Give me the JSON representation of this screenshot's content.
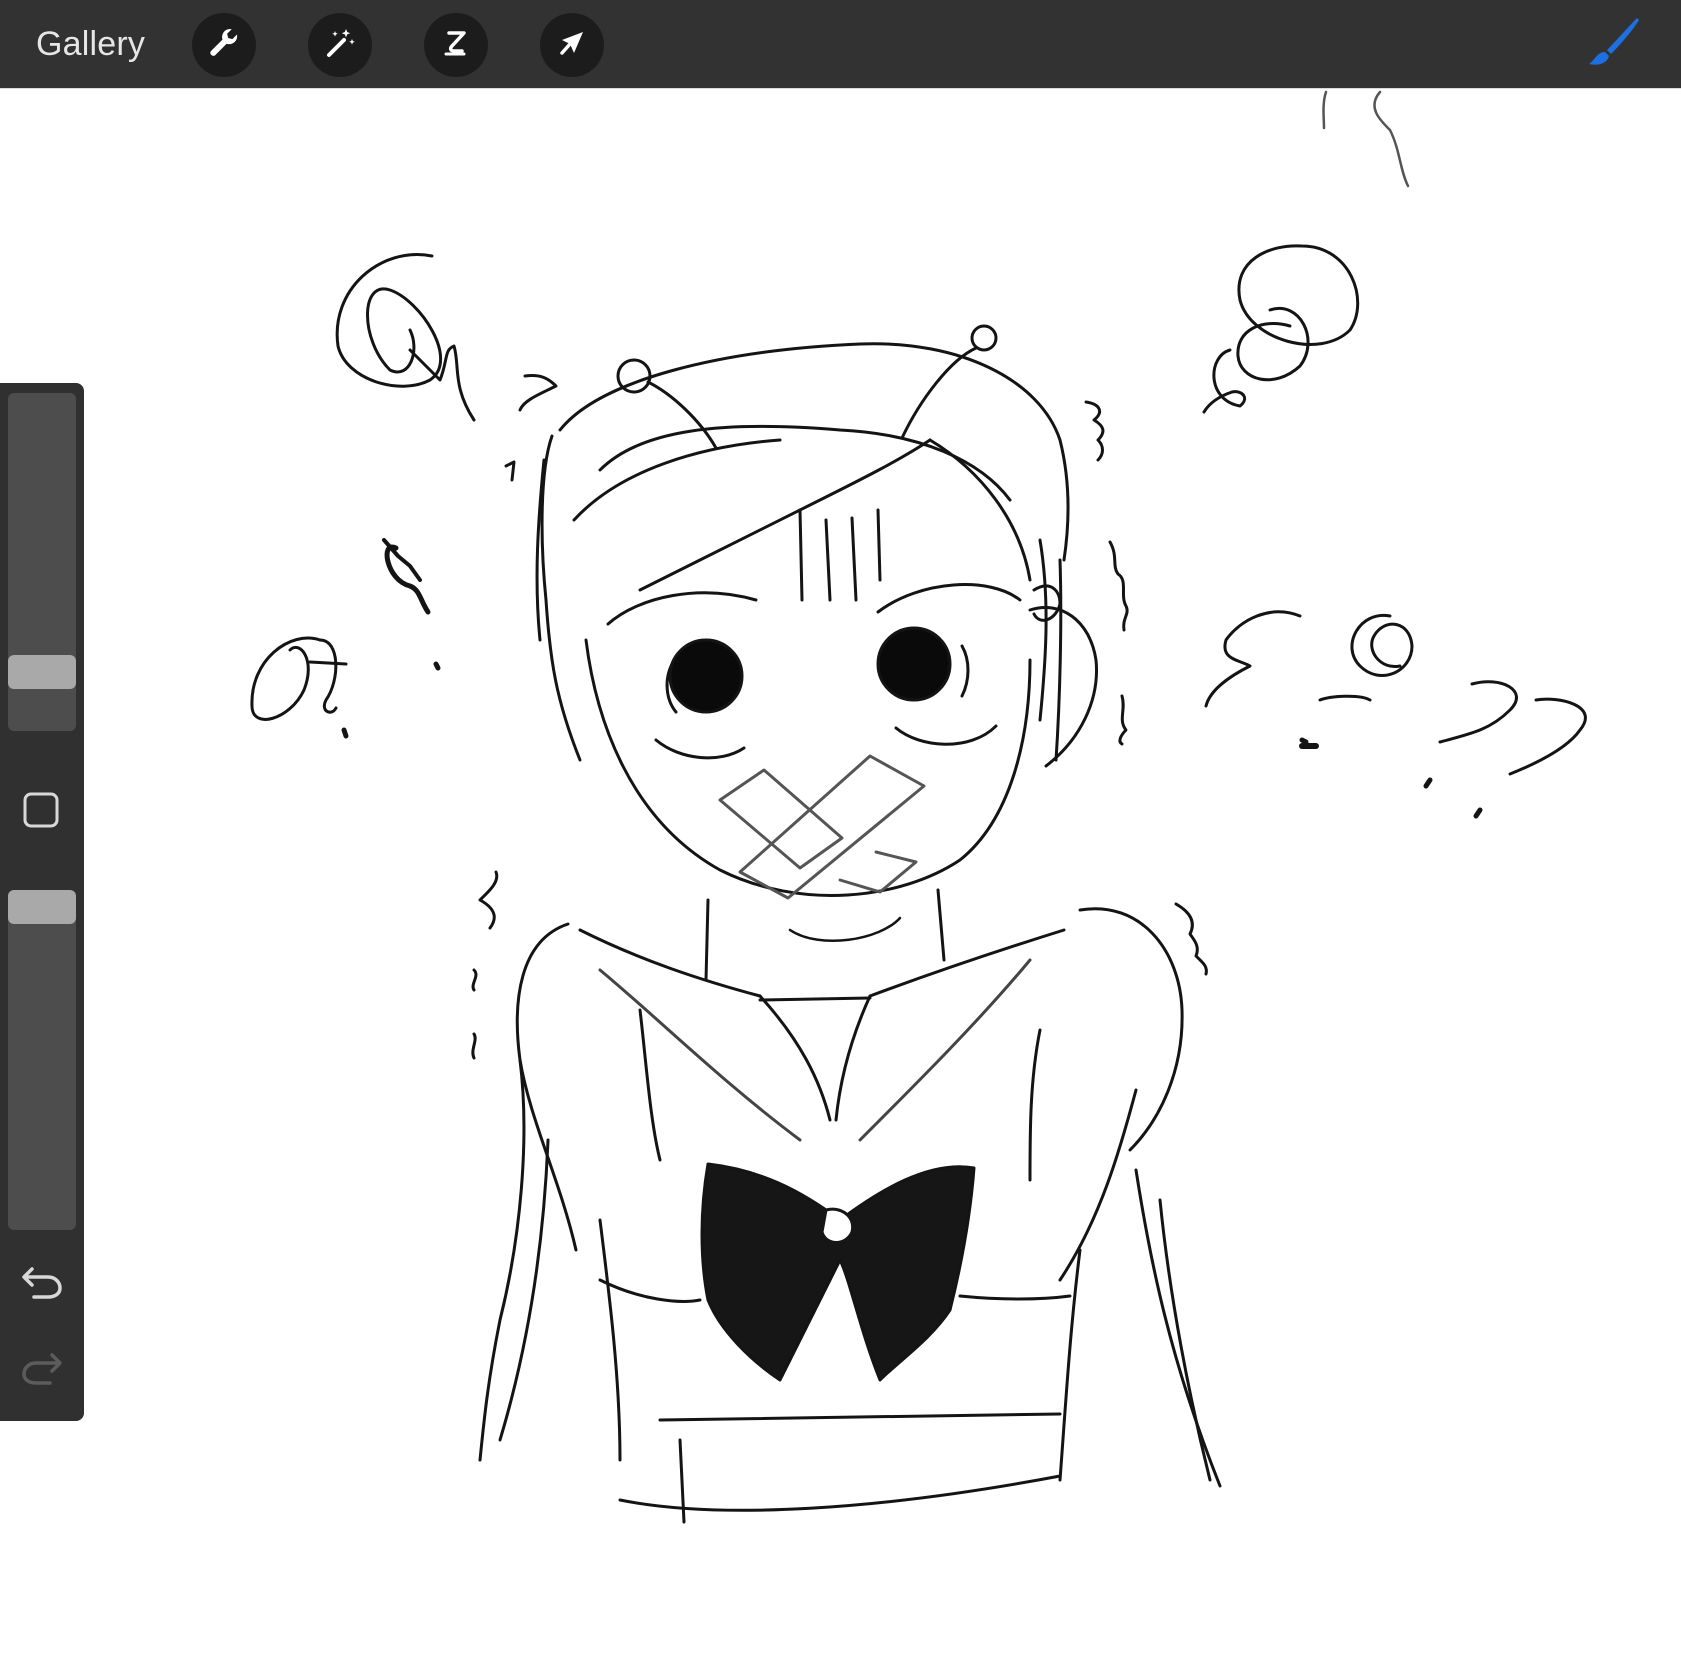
{
  "toolbar": {
    "gallery_label": "Gallery",
    "tools": [
      {
        "name": "actions",
        "icon": "wrench-icon"
      },
      {
        "name": "adjustments",
        "icon": "magic-wand-icon"
      },
      {
        "name": "selection",
        "icon": "selection-s-icon"
      },
      {
        "name": "transform",
        "icon": "arrow-cursor-icon"
      }
    ],
    "active_tool_icon": "brush-icon",
    "accent_color": "#1e6fe0"
  },
  "sidebar": {
    "brush_size_level": 0.25,
    "opacity_level": 1.0,
    "modify_icon": "square-icon",
    "undo_icon": "undo-icon",
    "redo_icon": "redo-icon",
    "redo_enabled": false
  },
  "canvas": {
    "description_color": "#111111",
    "background": "#ffffff"
  }
}
